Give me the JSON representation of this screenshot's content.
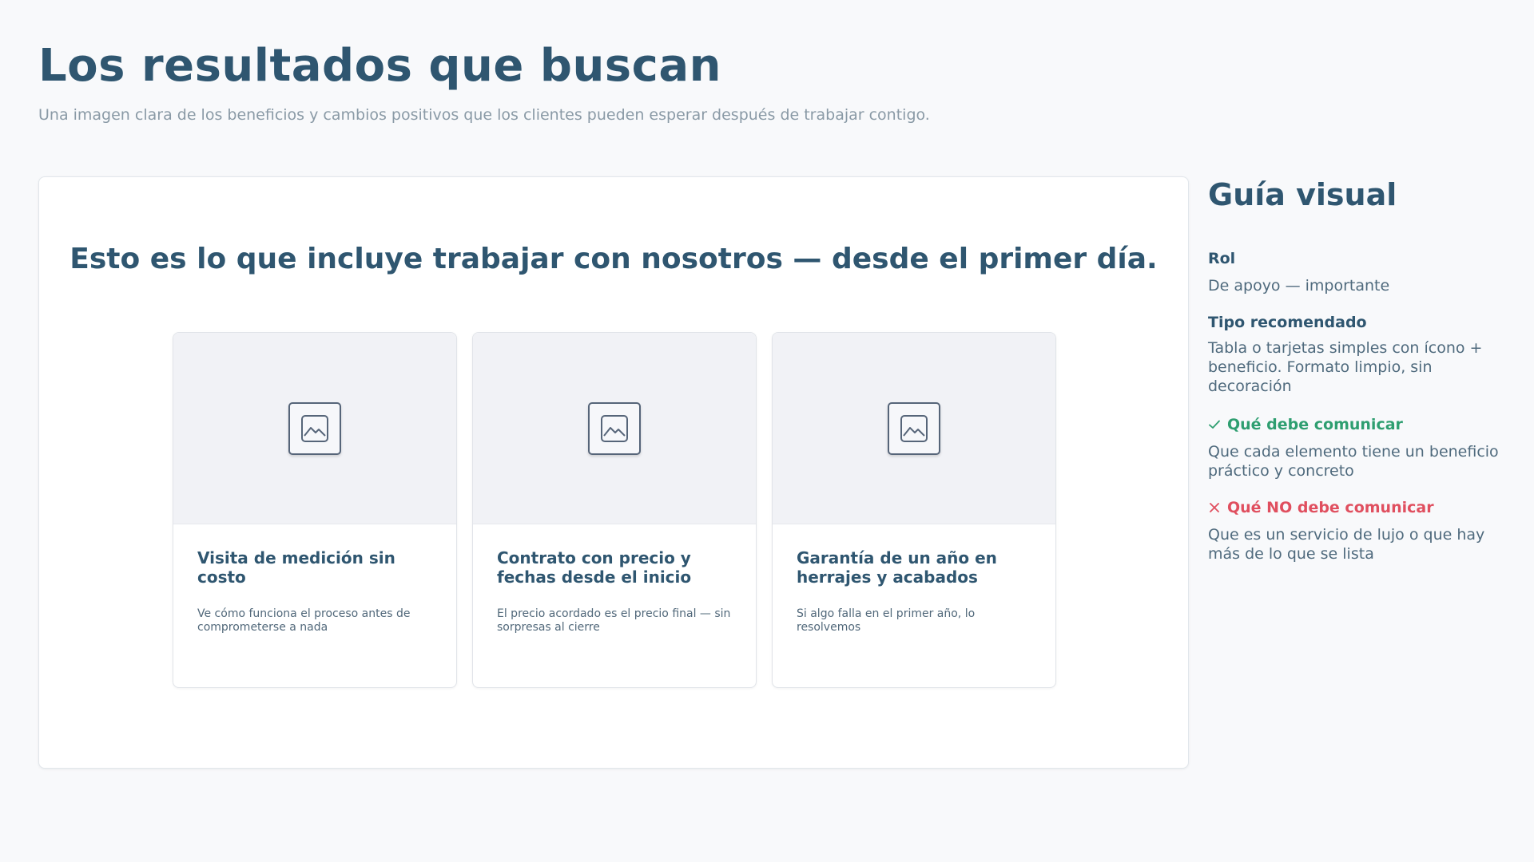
{
  "header": {
    "title": "Los resultados que buscan",
    "subtitle": "Una imagen clara de los beneficios y cambios positivos que los clientes pueden esperar después de trabajar contigo."
  },
  "preview": {
    "headline": "Esto es lo que incluye trabajar con nosotros — desde el primer día.",
    "cards": [
      {
        "icon": "image-placeholder-icon",
        "title": "Visita de medición sin costo",
        "description": "Ve cómo funciona el proceso antes de comprometerse a nada"
      },
      {
        "icon": "image-placeholder-icon",
        "title": "Contrato con precio y fechas desde el inicio",
        "description": "El precio acordado es el precio final — sin sorpresas al cierre"
      },
      {
        "icon": "image-placeholder-icon",
        "title": "Garantía de un año en herrajes y acabados",
        "description": "Si algo falla en el primer año, lo resolvemos"
      }
    ]
  },
  "guide": {
    "title": "Guía visual",
    "role_label": "Rol",
    "role_value": "De apoyo — importante",
    "type_label": "Tipo recomendado",
    "type_value": "Tabla o tarjetas simples con ícono + beneficio. Formato limpio, sin decoración",
    "do_label": "Qué debe comunicar",
    "do_icon": "check-icon",
    "do_value": "Que cada elemento tiene un beneficio práctico y concreto",
    "dont_label": "Qué NO debe comunicar",
    "dont_icon": "x-icon",
    "dont_value": "Que es un servicio de lujo o que hay más de lo que se lista"
  },
  "colors": {
    "primary": "#2f5670",
    "muted": "#8a9aa6",
    "do": "#2e9e70",
    "dont": "#e04f5f",
    "background": "#f8f9fb"
  }
}
